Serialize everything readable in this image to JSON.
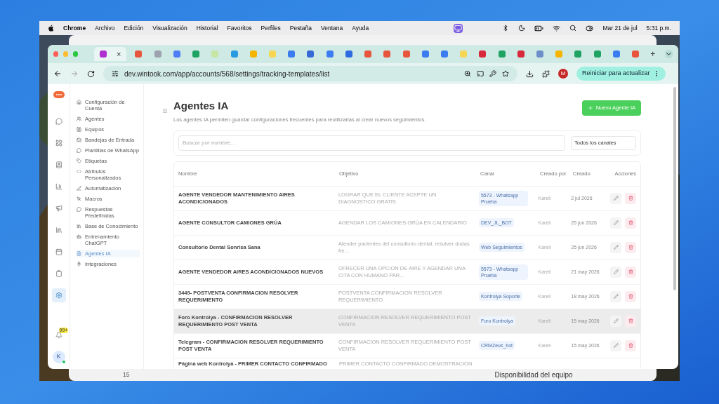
{
  "menu_bar": {
    "app": "Chrome",
    "items": [
      "Archivo",
      "Edición",
      "Visualización",
      "Historial",
      "Favoritos",
      "Perfiles",
      "Pestaña",
      "Ventana",
      "Ayuda"
    ],
    "date": "Mar 21 de jul",
    "time": "5:31 p.m."
  },
  "back_window": {
    "row_number": "15",
    "field": "Disponibilidad del equipo"
  },
  "browser": {
    "close_glyph": "×",
    "new_tab_glyph": "+",
    "tabs": [
      {
        "selected": true,
        "color": "#b02fd0"
      },
      {
        "selected": false,
        "color": "#e8553d"
      },
      {
        "selected": false,
        "color": "#9ca3af"
      },
      {
        "selected": false,
        "color": "#4f7df5"
      },
      {
        "selected": false,
        "color": "#1ea362"
      },
      {
        "selected": false,
        "color": "#c7e6a3"
      },
      {
        "selected": false,
        "color": "#2b9be0"
      },
      {
        "selected": false,
        "color": "#f4b400"
      },
      {
        "selected": false,
        "color": "#f5d652"
      },
      {
        "selected": false,
        "color": "#3b7cf0"
      },
      {
        "selected": false,
        "color": "#3569d6"
      },
      {
        "selected": false,
        "color": "#3b7cf0"
      },
      {
        "selected": false,
        "color": "#2f6be0"
      },
      {
        "selected": false,
        "color": "#e8553d"
      },
      {
        "selected": false,
        "color": "#e8553d"
      },
      {
        "selected": false,
        "color": "#e8553d"
      },
      {
        "selected": false,
        "color": "#3b7cf0"
      },
      {
        "selected": false,
        "color": "#3b7cf0"
      },
      {
        "selected": false,
        "color": "#f5d652"
      },
      {
        "selected": false,
        "color": "#d8283b"
      },
      {
        "selected": false,
        "color": "#1ea362"
      },
      {
        "selected": false,
        "color": "#d8283b"
      },
      {
        "selected": false,
        "color": "#6d8fc9"
      },
      {
        "selected": false,
        "color": "#f4b400"
      },
      {
        "selected": false,
        "color": "#1ea362"
      },
      {
        "selected": false,
        "color": "#1ea362"
      },
      {
        "selected": false,
        "color": "#3b7cf0"
      },
      {
        "selected": false,
        "color": "#e8553d"
      }
    ],
    "url": "dev.wintook.com/app/accounts/568/settings/tracking-templates/list",
    "profile_initial": "M",
    "update_button": "Reiniciar para actualizar"
  },
  "rail": {
    "items": [
      {
        "kind": "chat",
        "selected": false
      },
      {
        "kind": "board",
        "selected": false
      },
      {
        "kind": "contacts",
        "selected": false
      },
      {
        "kind": "chart",
        "selected": false
      },
      {
        "kind": "megaphone",
        "selected": false
      },
      {
        "kind": "library",
        "selected": false
      },
      {
        "kind": "calendar",
        "selected": false
      },
      {
        "kind": "clipboard",
        "selected": false
      },
      {
        "kind": "settings",
        "selected": true
      }
    ],
    "badge": "99+",
    "avatar": "K"
  },
  "sidebar": {
    "items": [
      {
        "kind": "home",
        "label": "Configuración de Cuenta",
        "selected": false
      },
      {
        "kind": "users",
        "label": "Agentes",
        "selected": false
      },
      {
        "kind": "team",
        "label": "Equipos",
        "selected": false
      },
      {
        "kind": "inbox",
        "label": "Bandejas de Entrada",
        "selected": false
      },
      {
        "kind": "chat",
        "label": "Plantillas de WhatsApp",
        "selected": false
      },
      {
        "kind": "tag",
        "label": "Etiquetas",
        "selected": false
      },
      {
        "kind": "code",
        "label": "Atributos Personalizados",
        "selected": false
      },
      {
        "kind": "pen",
        "label": "Automatización",
        "selected": false
      },
      {
        "kind": "pointer",
        "label": "Macros",
        "selected": false
      },
      {
        "kind": "chat",
        "label": "Respuestas Predefinidas",
        "selected": false
      },
      {
        "kind": "library",
        "label": "Base de Conocimiento",
        "selected": false
      },
      {
        "kind": "bot",
        "label": "Entrenamiento ChatGPT",
        "selected": false
      },
      {
        "kind": "file",
        "label": "Agentes IA",
        "selected": true
      },
      {
        "kind": "plug",
        "label": "Integraciones",
        "selected": false
      }
    ]
  },
  "page": {
    "title": "Agentes IA",
    "subtitle": "Los agentes IA permiten guardar configuraciones frecuentes para reutilizarlas al crear nuevos seguimientos.",
    "new_button": "Nuevo Agente IA",
    "search": {
      "placeholder": "Buscar por nombre..."
    },
    "channel_filter": "Todos los canales"
  },
  "table": {
    "columns": [
      "Nombre",
      "Objetivo",
      "Canal",
      "Creado por",
      "Creado",
      "Acciones"
    ],
    "rows": [
      {
        "name": "AGENTE VENDEDOR MANTENIMIENTO AIRES ACONDICIONADOS",
        "objective": "LOGRAR QUE EL CLIENTE ACEPTE UN DIAGNOSTICO GRATIS",
        "channel": "5573 - Whatsapp Prueba",
        "created_by": "Kareli",
        "created": "2 jul 2026",
        "highlighted": false
      },
      {
        "name": "AGENTE CONSULTOR CAMIONES GRÚA",
        "objective": "AGENDAR LOS CAMIONES GRÚA EN CALENDARIO",
        "channel": "DEV_JL_BOT",
        "created_by": "Kareli",
        "created": "25 jun 2026",
        "highlighted": false
      },
      {
        "name": "Consultorio Dental Sonrisa Sana",
        "objective": "Atender pacientes del consultorio dental, resolver dudas fre...",
        "channel": "Web Seguimientos",
        "created_by": "Kareli",
        "created": "25 jun 2026",
        "highlighted": false
      },
      {
        "name": "AGENTE VENDEDOR AIRES ACONDICIONADOS NUEVOS",
        "objective": "OFRECER UNA OPCION DE AIRE Y AGENDAR UNA CITA CON HUMANO PAR...",
        "channel": "5573 - Whatsapp Prueba",
        "created_by": "Kareli",
        "created": "21 may 2026",
        "highlighted": false
      },
      {
        "name": "3449- POSTVENTA CONFIRMACION RESOLVER REQUERIMIENTO",
        "objective": "POSTVENTA CONFIRMACION RESOLVER REQUERIMIENTO",
        "channel": "Kontrolya Soporte",
        "created_by": "Kareli",
        "created": "18 may 2026",
        "highlighted": false
      },
      {
        "name": "Foro Kontrolya - CONFIRMACION RESOLVER REQUERIMIENTO POST VENTA",
        "objective": "CONFIRMACION RESOLVER REQUERIMIENTO POST VENTA",
        "channel": "Foro Kontrolya",
        "created_by": "Kareli",
        "created": "15 may 2026",
        "highlighted": true
      },
      {
        "name": "Telegram - CONFIRMACION RESOLVER REQUERIMIENTO POST VENTA",
        "objective": "CONFIRMACION RESOLVER REQUERIMIENTO POST VENTA",
        "channel": "CRMZeus_bot",
        "created_by": "Kareli",
        "created": "15 may 2026",
        "highlighted": false
      },
      {
        "name": "Página web Kontrolya - PRIMER CONTACTO CONFIRMADO",
        "objective": "PRIMER CONTACTO CONFIRMADO DEMOSTRACION",
        "highlighted": false
      }
    ]
  }
}
